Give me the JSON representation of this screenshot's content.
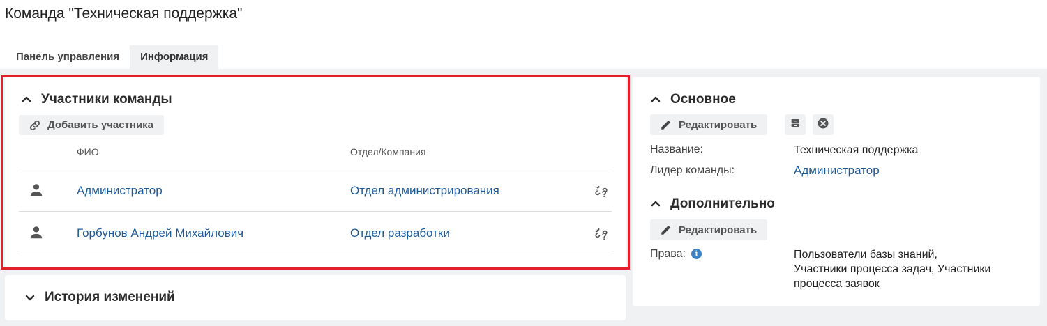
{
  "page": {
    "title": "Команда \"Техническая поддержка\""
  },
  "tabs": [
    {
      "label": "Панель управления",
      "active": false
    },
    {
      "label": "Информация",
      "active": true
    }
  ],
  "members": {
    "title": "Участники команды",
    "add_button": "Добавить участника",
    "columns": {
      "name": "ФИО",
      "department": "Отдел/Компания"
    },
    "rows": [
      {
        "name": "Администратор",
        "department": "Отдел администрирования",
        "icon": "person-icon",
        "action_icon": "unlink-icon"
      },
      {
        "name": "Горбунов Андрей Михайлович",
        "department": "Отдел разработки",
        "icon": "person-icon",
        "action_icon": "unlink-icon"
      }
    ]
  },
  "history": {
    "title": "История изменений"
  },
  "basic": {
    "title": "Основное",
    "edit_button": "Редактировать",
    "fields": {
      "name_label": "Название:",
      "name_value": "Техническая поддержка",
      "leader_label": "Лидер команды:",
      "leader_value": "Администратор"
    }
  },
  "additional": {
    "title": "Дополнительно",
    "edit_button": "Редактировать",
    "rights_label": "Права:",
    "rights_value_line1": "Пользователи базы знаний,",
    "rights_value_line2": "Участники процесса задач, Участники",
    "rights_value_line3": "процесса заявок"
  },
  "colors": {
    "link": "#1d5a99",
    "highlight": "#e0212b",
    "panel_bg": "#f0f1f3",
    "info_icon": "#3d82c4"
  }
}
